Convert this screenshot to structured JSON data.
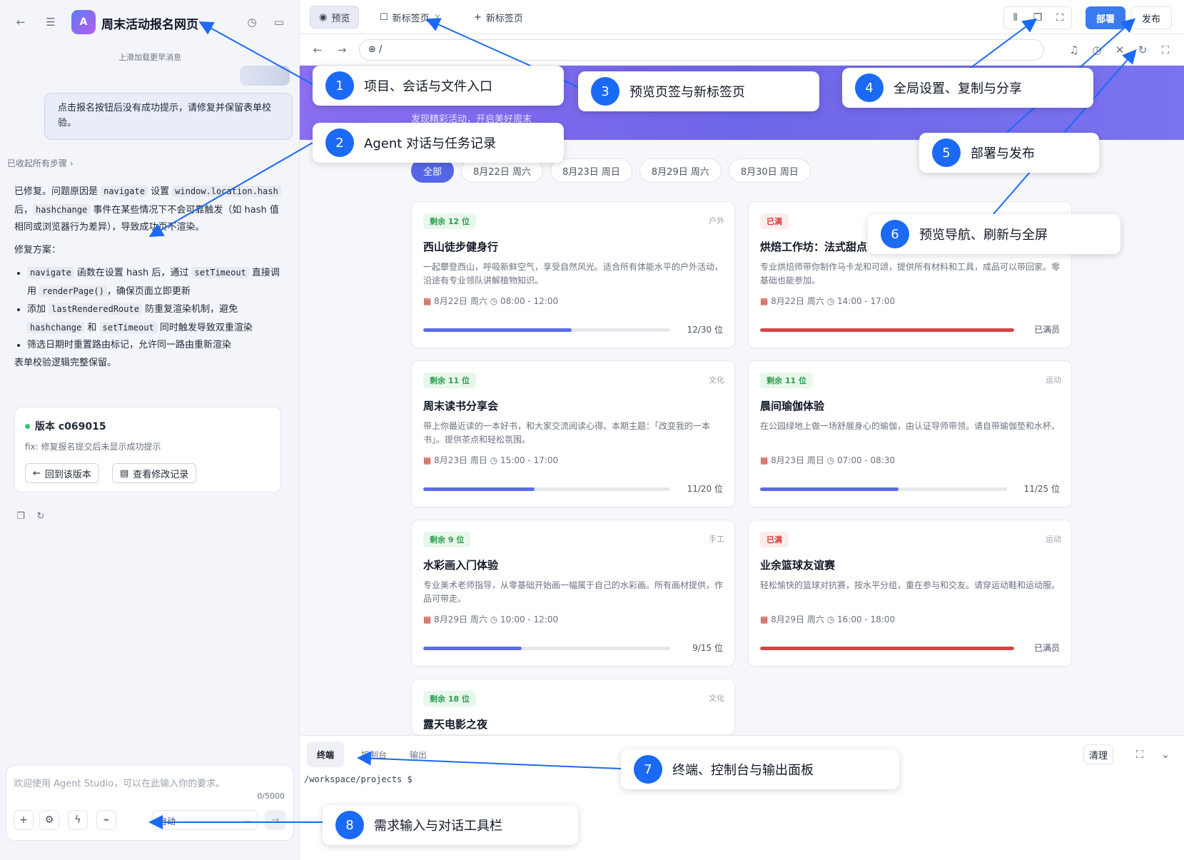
{
  "left": {
    "project_title": "周末活动报名网页",
    "load_more": "上滑加载更早消息",
    "user_message": "点击报名按钮后没有成功提示，请修复并保留表单校验。",
    "steps_toggle": "已收起所有步骤",
    "ai_p1_a": "已修复。问题原因是 ",
    "ai_p1_code1": "navigate",
    "ai_p1_b": " 设置 ",
    "ai_p1_code2": "window.location.hash",
    "ai_p1_c": " 后，",
    "ai_p1_code3": "hashchange",
    "ai_p1_d": " 事件在某些情况下不会可靠触发（如 hash 值相同或浏览器行为差异），导致成功页不渲染。",
    "ai_plan_title": "修复方案：",
    "ai_b1_code1": "navigate",
    "ai_b1_a": " 函数在设置 hash 后，通过 ",
    "ai_b1_code2": "setTimeout",
    "ai_b1_b": " 直接调用 ",
    "ai_b1_code3": "renderPage()",
    "ai_b1_c": "，确保页面立即更新",
    "ai_b2_a": "添加 ",
    "ai_b2_code1": "lastRenderedRoute",
    "ai_b2_b": " 防重复渲染机制，避免 ",
    "ai_b2_code2": "hashchange",
    "ai_b2_c": " 和 ",
    "ai_b2_code3": "setTimeout",
    "ai_b2_d": " 同时触发导致双重渲染",
    "ai_b3": "筛选日期时重置路由标记，允许同一路由重新渲染",
    "ai_end": "表单校验逻辑完整保留。",
    "version_title": "版本 c069015",
    "version_desc": "fix: 修复报名提交后未显示成功提示",
    "rollback_label": "回到该版本",
    "changes_label": "查看修改记录",
    "input_placeholder": "欢迎使用 Agent Studio，可以在此输入你的要求。",
    "char_count": "0/5000",
    "mode_label": "自动"
  },
  "tabs": {
    "preview": "预览",
    "new_tab_1": "新标签页",
    "new_tab_2": "新标签页"
  },
  "toolbar": {
    "deploy": "部署",
    "publish": "发布"
  },
  "nav": {
    "url": "/"
  },
  "hero": {
    "subtitle": "发现精彩活动，开启美好周末"
  },
  "filters": [
    "全部",
    "8月22日 周六",
    "8月23日 周日",
    "8月29日 周六",
    "8月30日 周日"
  ],
  "cards": [
    {
      "badge": "剩余 12 位",
      "status": "ok",
      "category": "户外",
      "title": "西山徒步健身行",
      "desc": "一起攀登西山，呼吸新鲜空气，享受自然风光。适合所有体能水平的户外活动，沿途有专业领队讲解植物知识。",
      "date": "8月22日 周六",
      "time": "08:00 - 12:00",
      "capacity": "12/30 位",
      "fill": 0.6,
      "color": "#5b6ce6"
    },
    {
      "badge": "已满",
      "status": "full",
      "category": "",
      "title": "烘焙工作坊：法式甜点",
      "desc": "专业烘焙师带你制作马卡龙和可颂，提供所有材料和工具，成品可以带回家。零基础也能参加。",
      "date": "8月22日 周六",
      "time": "14:00 - 17:00",
      "capacity": "已满员",
      "fill": 1,
      "color": "#d64545"
    },
    {
      "badge": "剩余 11 位",
      "status": "ok",
      "category": "文化",
      "title": "周末读书分享会",
      "desc": "带上你最近读的一本好书，和大家交流阅读心得。本期主题：「改变我的一本书」。提供茶点和轻松氛围。",
      "date": "8月23日 周日",
      "time": "15:00 - 17:00",
      "capacity": "11/20 位",
      "fill": 0.45,
      "color": "#5b6ce6"
    },
    {
      "badge": "剩余 11 位",
      "status": "ok",
      "category": "运动",
      "title": "晨间瑜伽体验",
      "desc": "在公园绿地上做一场舒展身心的瑜伽，由认证导师带领。请自带瑜伽垫和水杯。",
      "date": "8月23日 周日",
      "time": "07:00 - 08:30",
      "capacity": "11/25 位",
      "fill": 0.56,
      "color": "#5b6ce6"
    },
    {
      "badge": "剩余 9 位",
      "status": "ok",
      "category": "手工",
      "title": "水彩画入门体验",
      "desc": "专业美术老师指导，从零基础开始画一幅属于自己的水彩画。所有画材提供，作品可带走。",
      "date": "8月29日 周六",
      "time": "10:00 - 12:00",
      "capacity": "9/15 位",
      "fill": 0.4,
      "color": "#5b6ce6"
    },
    {
      "badge": "已满",
      "status": "full",
      "category": "运动",
      "title": "业余篮球友谊赛",
      "desc": "轻松愉快的篮球对抗赛，按水平分组，重在参与和交友。请穿运动鞋和运动服。",
      "date": "8月29日 周六",
      "time": "16:00 - 18:00",
      "capacity": "已满员",
      "fill": 1,
      "color": "#d64545"
    },
    {
      "badge": "剩余 18 位",
      "status": "ok",
      "category": "文化",
      "title": "露天电影之夜",
      "desc": "",
      "date": "",
      "time": "",
      "capacity": "",
      "fill": 0,
      "color": "#5b6ce6"
    }
  ],
  "terminal": {
    "tab_terminal": "终端",
    "tab_console": "控制台",
    "tab_output": "输出",
    "clear": "清理",
    "prompt": "/workspace/projects $"
  },
  "callouts": [
    {
      "num": "1",
      "label": "项目、会话与文件入口"
    },
    {
      "num": "2",
      "label": "Agent 对话与任务记录"
    },
    {
      "num": "3",
      "label": "预览页签与新标签页"
    },
    {
      "num": "4",
      "label": "全局设置、复制与分享"
    },
    {
      "num": "5",
      "label": "部署与发布"
    },
    {
      "num": "6",
      "label": "预览导航、刷新与全屏"
    },
    {
      "num": "7",
      "label": "终端、控制台与输出面板"
    },
    {
      "num": "8",
      "label": "需求输入与对话工具栏"
    }
  ]
}
